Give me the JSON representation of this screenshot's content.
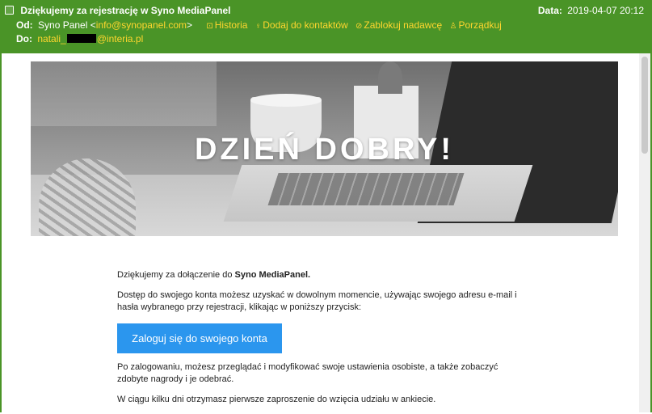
{
  "header": {
    "subject": "Dziękujemy za rejestrację w Syno MediaPanel",
    "date_label": "Data:",
    "date_value": "2019-04-07 20:12",
    "from_label": "Od:",
    "from_name": "Syno Panel",
    "from_email": "info@synopanel.com",
    "to_label": "Do:",
    "to_email_prefix": "natali_",
    "to_email_suffix": "@interia.pl",
    "actions": [
      {
        "label": "Historia",
        "icon": "history-icon"
      },
      {
        "label": "Dodaj do kontaktów",
        "icon": "add-contact-icon"
      },
      {
        "label": "Zablokuj nadawcę",
        "icon": "block-icon"
      },
      {
        "label": "Porządkuj",
        "icon": "tidy-icon"
      }
    ]
  },
  "hero": {
    "title": "DZIEŃ DOBRY!"
  },
  "body": {
    "p1_text": "Dziękujemy za dołączenie do ",
    "p1_bold": "Syno MediaPanel.",
    "p2": "Dostęp do swojego konta możesz uzyskać w dowolnym momencie, używając swojego adresu e-mail i hasła wybranego przy rejestracji, klikając w poniższy przycisk:",
    "button_label": "Zaloguj się do swojego konta",
    "p3": "Po zalogowaniu, możesz przeglądać i modyfikować swoje ustawienia osobiste, a także zobaczyć zdobyte nagrody i je odebrać.",
    "p4": "W ciągu kilku dni otrzymasz pierwsze zaproszenie do wzięcia udziału w ankiecie."
  },
  "colors": {
    "header_bg": "#4a9427",
    "link": "#ffd62e",
    "button_bg": "#2b96ee"
  }
}
